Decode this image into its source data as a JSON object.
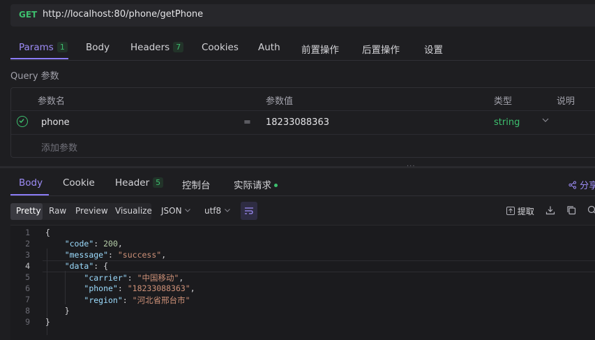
{
  "request": {
    "method": "GET",
    "url": "http://localhost:80/phone/getPhone"
  },
  "request_tabs": [
    {
      "label": "Params",
      "badge": "1"
    },
    {
      "label": "Body",
      "badge": ""
    },
    {
      "label": "Headers",
      "badge": "7"
    },
    {
      "label": "Cookies",
      "badge": ""
    },
    {
      "label": "Auth",
      "badge": ""
    },
    {
      "label": "前置操作",
      "badge": ""
    },
    {
      "label": "后置操作",
      "badge": ""
    },
    {
      "label": "设置",
      "badge": ""
    }
  ],
  "query": {
    "label": "Query 参数",
    "columns": {
      "name": "参数名",
      "value": "参数值",
      "type": "类型",
      "desc": "说明"
    },
    "rows": [
      {
        "checked": true,
        "name": "phone",
        "eq": "=",
        "value": "18233088363",
        "type": "string"
      }
    ],
    "add_placeholder": "添加参数"
  },
  "response_tabs": [
    {
      "label": "Body",
      "badge": ""
    },
    {
      "label": "Cookie",
      "badge": ""
    },
    {
      "label": "Header",
      "badge": "5"
    },
    {
      "label": "控制台",
      "badge": ""
    },
    {
      "label": "实际请求",
      "badge": ""
    }
  ],
  "share_label": "分享",
  "toolbar": {
    "views": [
      "Pretty",
      "Raw",
      "Preview",
      "Visualize"
    ],
    "format": "JSON",
    "encoding": "utf8",
    "extract_label": "提取"
  },
  "code_lines": [
    {
      "n": "1",
      "html": "{"
    },
    {
      "n": "2",
      "html": "    <span class='k'>\"code\"</span>: <span class='n'>200</span>,"
    },
    {
      "n": "3",
      "html": "    <span class='k'>\"message\"</span>: <span class='s'>\"success\"</span>,"
    },
    {
      "n": "4",
      "html": "    <span class='k'>\"data\"</span>: {"
    },
    {
      "n": "5",
      "html": "        <span class='k'>\"carrier\"</span>: <span class='s'>\"中国移动\"</span>,"
    },
    {
      "n": "6",
      "html": "        <span class='k'>\"phone\"</span>: <span class='s'>\"18233088363\"</span>,"
    },
    {
      "n": "7",
      "html": "        <span class='k'>\"region\"</span>: <span class='s'>\"河北省邢台市\"</span>"
    },
    {
      "n": "8",
      "html": "    }"
    },
    {
      "n": "9",
      "html": "}"
    }
  ],
  "colors": {
    "accent": "#8b7cf6",
    "green": "#3dbf6e",
    "background": "#1e1e21"
  }
}
